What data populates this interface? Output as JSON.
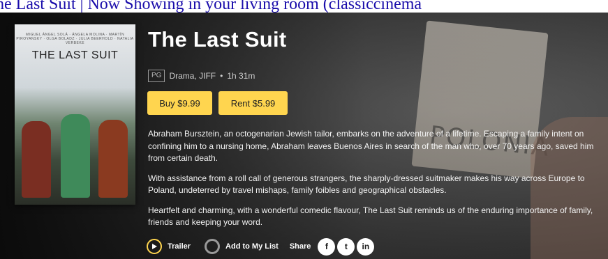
{
  "top_link": {
    "text": "he Last Suit | Now Showing in your living room (classiccinema"
  },
  "movie": {
    "title": "The Last Suit",
    "rating": "PG",
    "genres": "Drama, JIFF",
    "separator": "•",
    "duration": "1h 31m",
    "poster": {
      "title": "THE LAST SUIT",
      "credits": "MIGUEL ÁNGEL SOLÁ · ÁNGELA MOLINA · MARTÍN PIROYANSKY · OLGA BOLADZ · JULIA BEERHOLD · NATALIA VERBEKE"
    }
  },
  "buttons": {
    "buy_label": "Buy $9.99",
    "rent_label": "Rent $5.99"
  },
  "description": [
    "Abraham Bursztein, an octogenarian Jewish tailor, embarks on the adventure of a lifetime. Escaping a family intent on confining him to a nursing home, Abraham leaves Buenos Aires in search of the man who, over 70 years ago, saved him from certain death.",
    "With assistance from a roll call of generous strangers, the sharply-dressed suitmaker makes his way across Europe to Poland, undeterred by travel mishaps, family foibles and geographical obstacles.",
    "Heartfelt and charming, with a wonderful comedic flavour, The Last Suit reminds us of the enduring importance of family, friends and keeping your word."
  ],
  "actions": {
    "trailer_label": "Trailer",
    "add_label": "Add to My List",
    "share_label": "Share",
    "social": [
      {
        "icon": "facebook-icon",
        "glyph": "f"
      },
      {
        "icon": "twitter-icon",
        "glyph": "t"
      },
      {
        "icon": "linkedin-icon",
        "glyph": "in"
      }
    ]
  },
  "background": {
    "sign_text": "POLONIA"
  },
  "colors": {
    "accent": "#ffd54f",
    "text": "#ffffff",
    "link": "#1a0dab"
  }
}
